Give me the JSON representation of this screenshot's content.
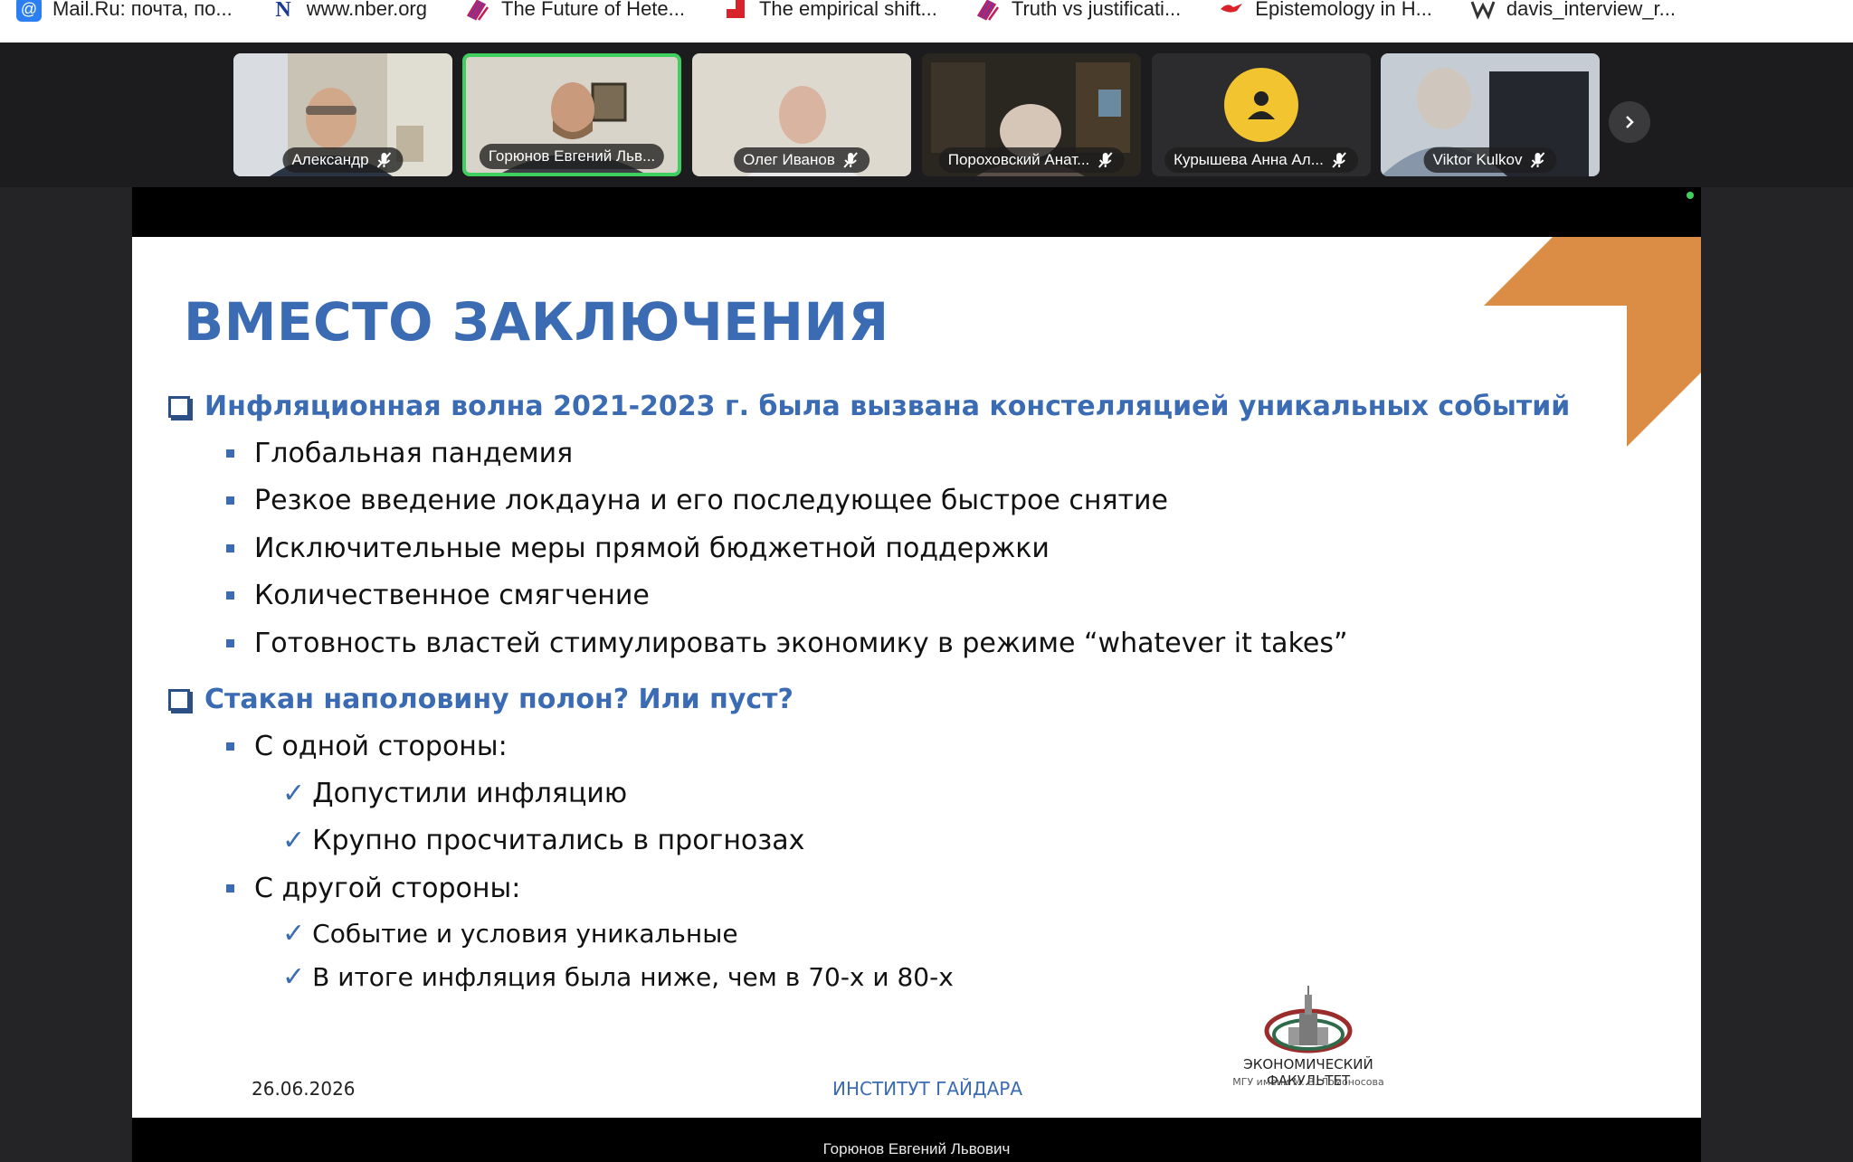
{
  "bookmarks": [
    {
      "label": "Mail.Ru: почта, по...",
      "icon": "mailru-icon"
    },
    {
      "label": "www.nber.org",
      "icon": "nber-icon"
    },
    {
      "label": "The Future of Hete...",
      "icon": "stripes-icon"
    },
    {
      "label": "The empirical shift...",
      "icon": "red-square-icon"
    },
    {
      "label": "Truth vs justificati...",
      "icon": "stripes-icon"
    },
    {
      "label": "Epistemology in H...",
      "icon": "bird-icon"
    },
    {
      "label": "davis_interview_r...",
      "icon": "w-icon"
    }
  ],
  "participants": [
    {
      "name": "Александр",
      "muted": true,
      "active": false,
      "video": true
    },
    {
      "name": "Горюнов Евгений Льв...",
      "muted": false,
      "active": true,
      "video": true
    },
    {
      "name": "Олег Иванов",
      "muted": true,
      "active": false,
      "video": true
    },
    {
      "name": "Пороховский Анат...",
      "muted": true,
      "active": false,
      "video": true
    },
    {
      "name": "Курышева Анна Ал...",
      "muted": true,
      "active": false,
      "video": false
    },
    {
      "name": "Viktor Kulkov",
      "muted": true,
      "active": false,
      "video": true
    }
  ],
  "share": {
    "speaker": "Горюнов Евгений Львович"
  },
  "slide": {
    "title": "ВМЕСТО ЗАКЛЮЧЕНИЯ",
    "section1": {
      "heading": "Инфляционная волна 2021-2023 г. была вызвана констелляцией уникальных событий",
      "bullets": [
        "Глобальная пандемия",
        "Резкое введение локдауна и его последующее быстрое снятие",
        "Исключительные меры прямой бюджетной поддержки",
        "Количественное смягчение",
        "Готовность властей стимулировать экономику в режиме “whatever it takes”"
      ]
    },
    "section2": {
      "heading": "Стакан наполовину полон? Или пуст?",
      "side1": "С одной стороны:",
      "side1_items": [
        "Допустили  инфляцию",
        "Крупно просчитались в прогнозах"
      ],
      "side2": "С другой стороны:",
      "side2_items": [
        "Событие и условия уникальные",
        "В итоге инфляция была ниже, чем в 70-х и 80-х"
      ]
    },
    "footer": {
      "date": "26.06.2026",
      "institute": "ИНСТИТУТ ГАЙДАРА",
      "logo_title": "ЭКОНОМИЧЕСКИЙ ФАКУЛЬТЕТ",
      "logo_subtitle": "МГУ имени М. В. Ломоносова"
    },
    "accent_color": "#3a6bb3",
    "corner_color": "#dc8d45"
  }
}
